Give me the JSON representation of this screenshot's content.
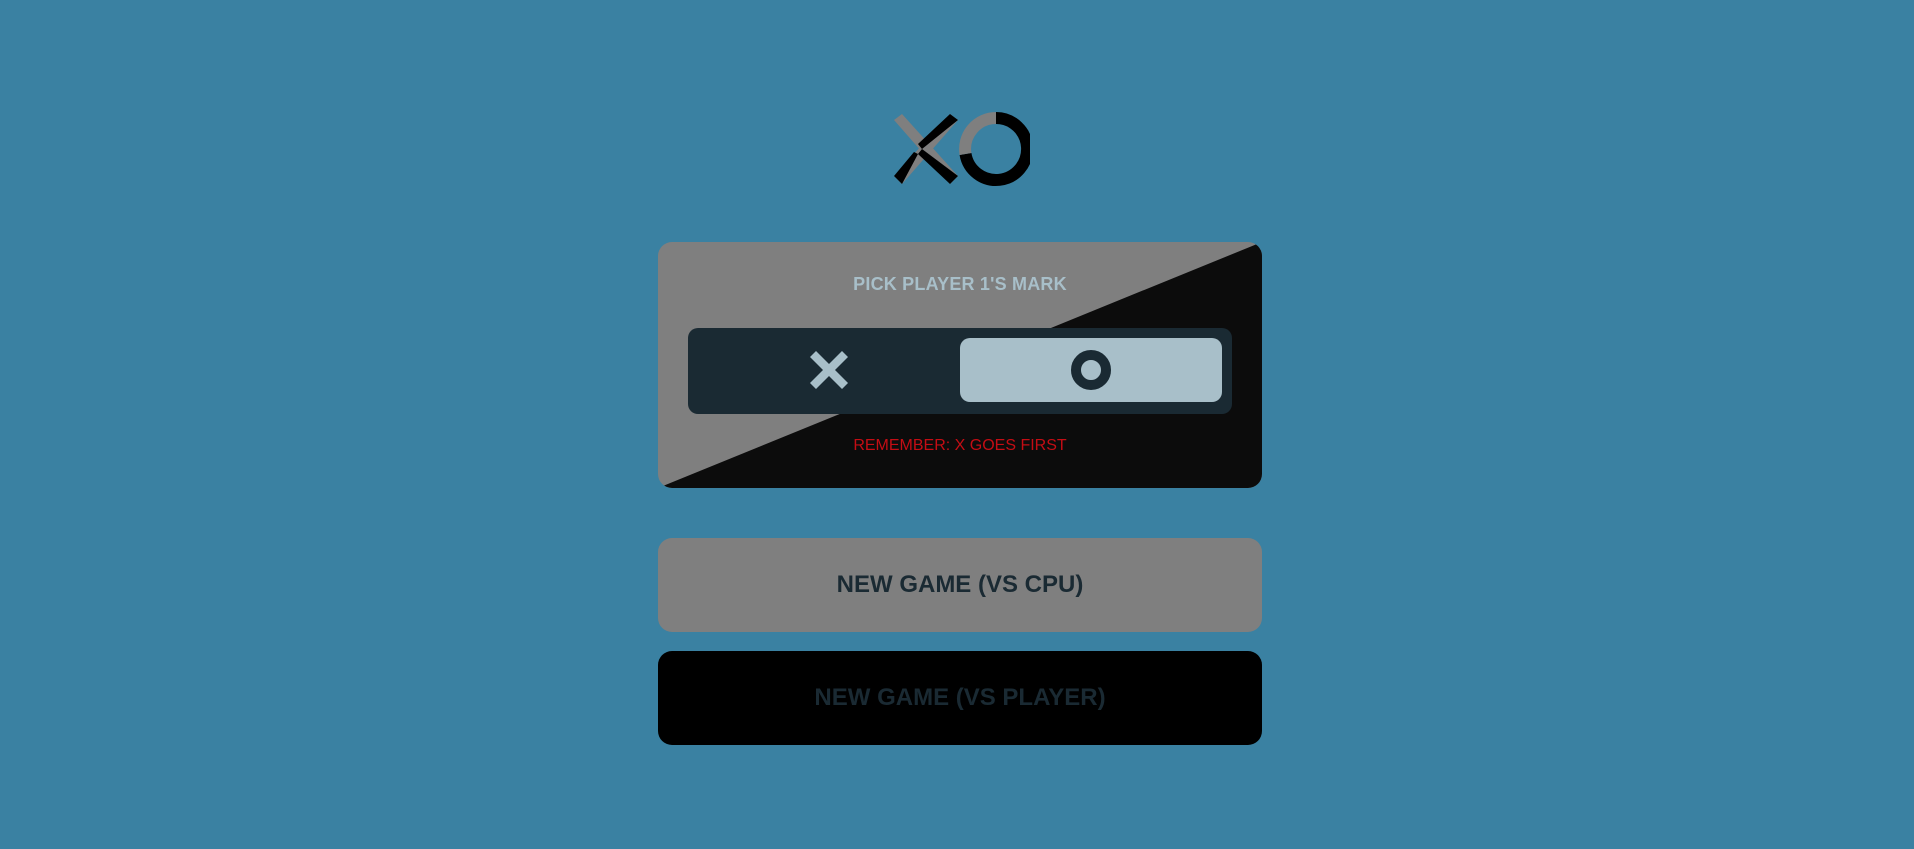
{
  "logo": {
    "text": "XO",
    "icon": "xo-logo-icon"
  },
  "mark_picker": {
    "title": "PICK PLAYER 1'S MARK",
    "options": [
      {
        "mark": "X",
        "icon": "x-mark-icon",
        "selected": false
      },
      {
        "mark": "O",
        "icon": "o-mark-icon",
        "selected": true
      }
    ],
    "hint": "REMEMBER: X GOES FIRST"
  },
  "buttons": {
    "vs_cpu": "NEW GAME (VS CPU)",
    "vs_player": "NEW GAME (VS PLAYER)"
  },
  "colors": {
    "background": "#3a81a2",
    "dark_navy": "#1a2a33",
    "silver": "#a8bfc9",
    "gray": "#7f7f7f",
    "hint_red": "#c40d14"
  }
}
